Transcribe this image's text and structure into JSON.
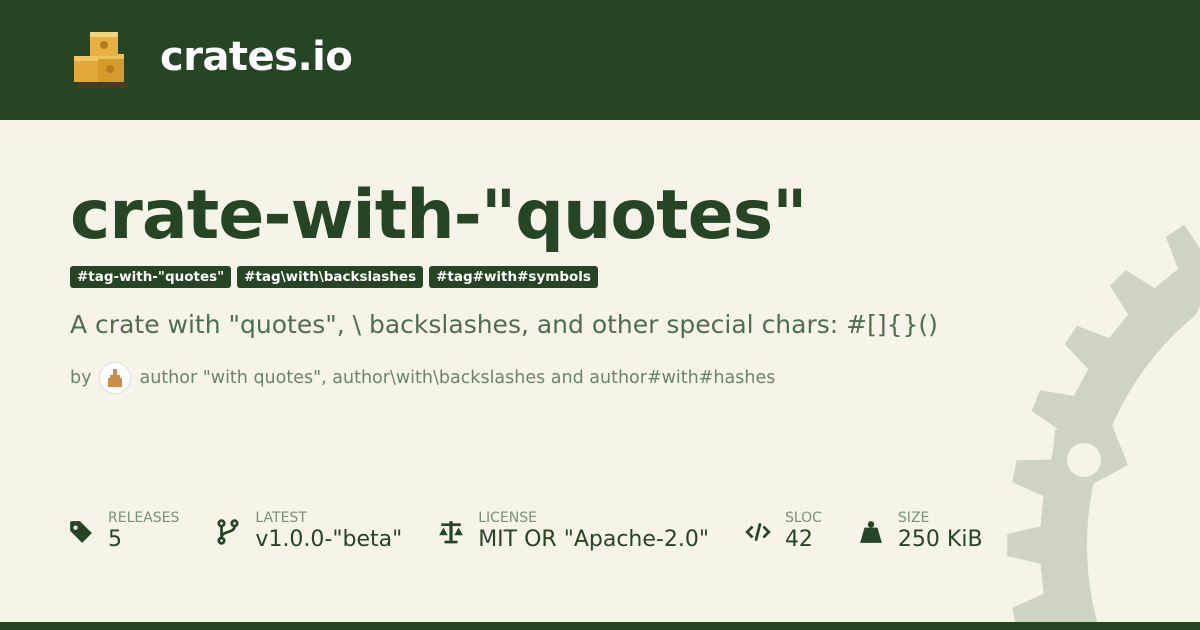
{
  "header": {
    "brand": "crates.io",
    "logo_icon": "crates-boxes-logo"
  },
  "crate": {
    "name": "crate-with-\"quotes\"",
    "tags": [
      "#tag-with-\"quotes\"",
      "#tag\\with\\backslashes",
      "#tag#with#symbols"
    ],
    "description": "A crate with \"quotes\", \\ backslashes, and other special chars: #[]{}()",
    "by_label": "by",
    "authors": "author \"with quotes\", author\\with\\backslashes and author#with#hashes"
  },
  "stats": [
    {
      "icon": "tag-icon",
      "label": "RELEASES",
      "value": "5"
    },
    {
      "icon": "branch-icon",
      "label": "LATEST",
      "value": "v1.0.0-\"beta\""
    },
    {
      "icon": "scale-icon",
      "label": "LICENSE",
      "value": "MIT OR \"Apache-2.0\""
    },
    {
      "icon": "code-icon",
      "label": "SLOC",
      "value": "42"
    },
    {
      "icon": "weight-icon",
      "label": "SIZE",
      "value": "250 KiB"
    }
  ],
  "colors": {
    "brand": "#254525",
    "background": "#f6f4e9",
    "gear": "#cfd3c3",
    "muted": "#4f6e50"
  }
}
